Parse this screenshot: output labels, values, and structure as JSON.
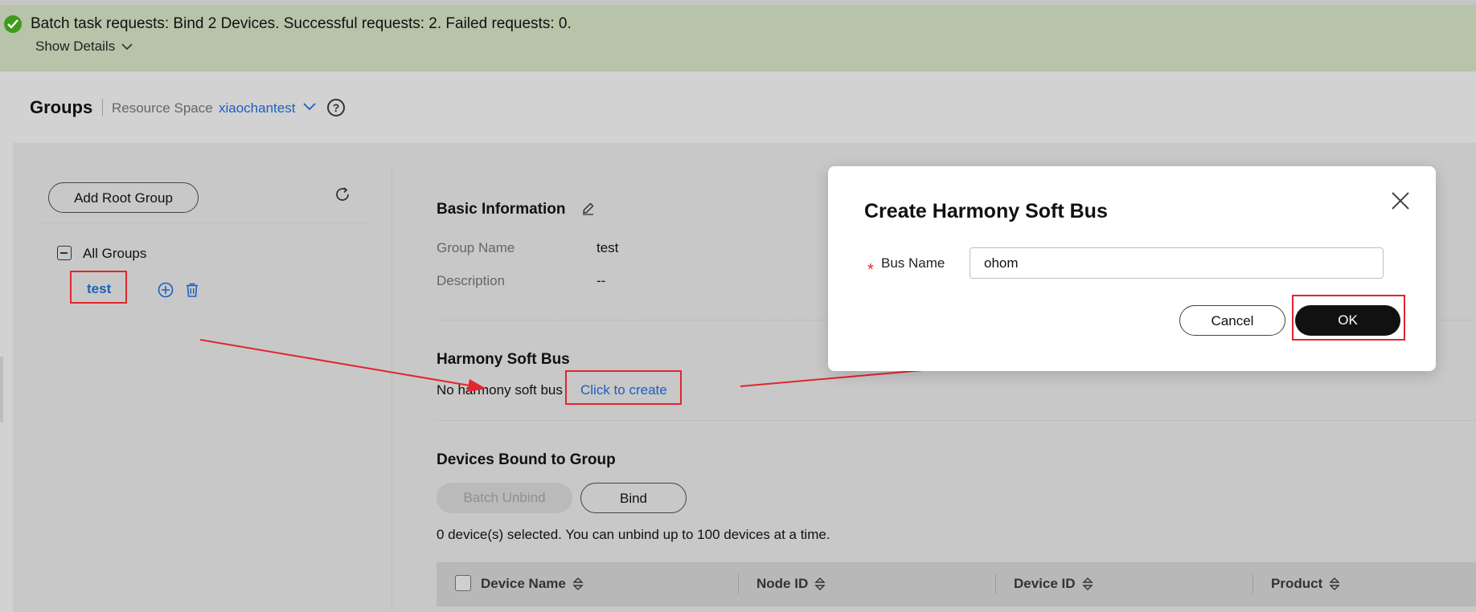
{
  "banner": {
    "message": "Batch task requests: Bind 2 Devices. Successful requests: 2. Failed requests: 0.",
    "show_details": "Show Details"
  },
  "header": {
    "title": "Groups",
    "resource_space_label": "Resource Space",
    "resource_space_value": "xiaochantest",
    "help": "?"
  },
  "tree": {
    "add_root_label": "Add Root Group",
    "root_label": "All Groups",
    "selected_group": "test"
  },
  "basic_info": {
    "title": "Basic Information",
    "group_name_label": "Group Name",
    "group_name_value": "test",
    "description_label": "Description",
    "description_value": "--"
  },
  "harmony": {
    "title": "Harmony Soft Bus",
    "empty_text": "No harmony soft bus",
    "create_link": "Click to create"
  },
  "devices": {
    "title": "Devices Bound to Group",
    "batch_unbind_label": "Batch Unbind",
    "bind_label": "Bind",
    "selection_note": "0 device(s) selected. You can unbind up to 100 devices at a time.",
    "columns": [
      "Device Name",
      "Node ID",
      "Device ID",
      "Product"
    ]
  },
  "modal": {
    "title": "Create Harmony Soft Bus",
    "required_mark": "*",
    "bus_name_label": "Bus Name",
    "bus_name_value": "ohom",
    "cancel_label": "Cancel",
    "ok_label": "OK"
  },
  "colors": {
    "banner_bg": "#b7c4a9",
    "success_green": "#3f9a1c",
    "link_blue": "#1d5fbf",
    "annotation_red": "#e0262f",
    "primary_button": "#111111"
  }
}
